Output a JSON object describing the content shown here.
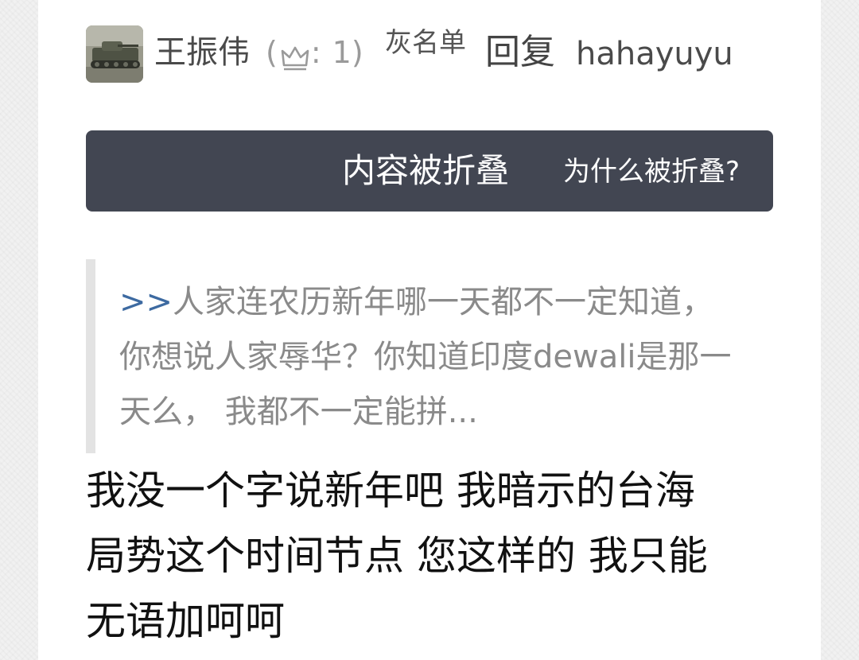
{
  "header": {
    "username": "王振伟",
    "level_prefix": "(",
    "level_sep": ":",
    "level_value": "1)",
    "gray_list_label": "灰名单",
    "reply_word": "回复",
    "reply_target": "hahayuyu"
  },
  "folded": {
    "title": "内容被折叠",
    "why_link": "为什么被折叠?"
  },
  "quote": {
    "marker": ">>",
    "text": "人家连农历新年哪一天都不一定知道，你想说人家辱华？你知道印度dewali是那一天么， 我都不一定能拼..."
  },
  "body": {
    "lines": [
      "我没一个字说新年吧 我暗示的台海",
      "局势这个时间节点 您这样的 我只能",
      "无语加呵呵"
    ]
  },
  "icons": {
    "avatar": "tank-avatar",
    "level": "crown-icon"
  },
  "colors": {
    "banner_bg": "#424652",
    "quote_marker": "#3d6aa1",
    "quote_text": "#8a8a8a"
  }
}
